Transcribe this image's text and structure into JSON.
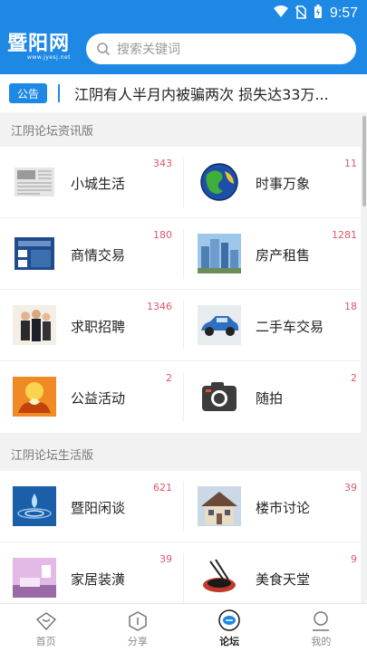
{
  "status": {
    "time": "9:57"
  },
  "header": {
    "logo_text": "暨阳网",
    "logo_sub": "www.jyesj.net"
  },
  "search": {
    "placeholder": "搜索关键词"
  },
  "notice": {
    "tag": "公告",
    "text": "江阴有人半月内被骗两次 损失达33万..."
  },
  "sections": [
    {
      "title": "江阴论坛资讯版",
      "items": [
        {
          "label": "小城生活",
          "count": "343",
          "icon": "newspaper-thumb"
        },
        {
          "label": "时事万象",
          "count": "11",
          "icon": "globe-thumb"
        },
        {
          "label": "商情交易",
          "count": "180",
          "icon": "trade-thumb"
        },
        {
          "label": "房产租售",
          "count": "1281",
          "icon": "buildings-thumb"
        },
        {
          "label": "求职招聘",
          "count": "1346",
          "icon": "people-thumb"
        },
        {
          "label": "二手车交易",
          "count": "18",
          "icon": "car-thumb"
        },
        {
          "label": "公益活动",
          "count": "2",
          "icon": "charity-thumb"
        },
        {
          "label": "随拍",
          "count": "2",
          "icon": "camera-thumb"
        }
      ]
    },
    {
      "title": "江阴论坛生活版",
      "items": [
        {
          "label": "暨阳闲谈",
          "count": "621",
          "icon": "water-drop-thumb"
        },
        {
          "label": "楼市讨论",
          "count": "39",
          "icon": "house-thumb"
        },
        {
          "label": "家居装潢",
          "count": "39",
          "icon": "interior-thumb"
        },
        {
          "label": "美食天堂",
          "count": "9",
          "icon": "food-thumb"
        }
      ]
    }
  ],
  "tabs": [
    {
      "label": "首页",
      "icon": "home-diamond-icon",
      "active": false
    },
    {
      "label": "分享",
      "icon": "share-hexagon-icon",
      "active": false
    },
    {
      "label": "论坛",
      "icon": "forum-chat-icon",
      "active": true
    },
    {
      "label": "我的",
      "icon": "profile-person-icon",
      "active": false
    }
  ],
  "colors": {
    "primary": "#1e88e5",
    "count": "#e3566c"
  }
}
